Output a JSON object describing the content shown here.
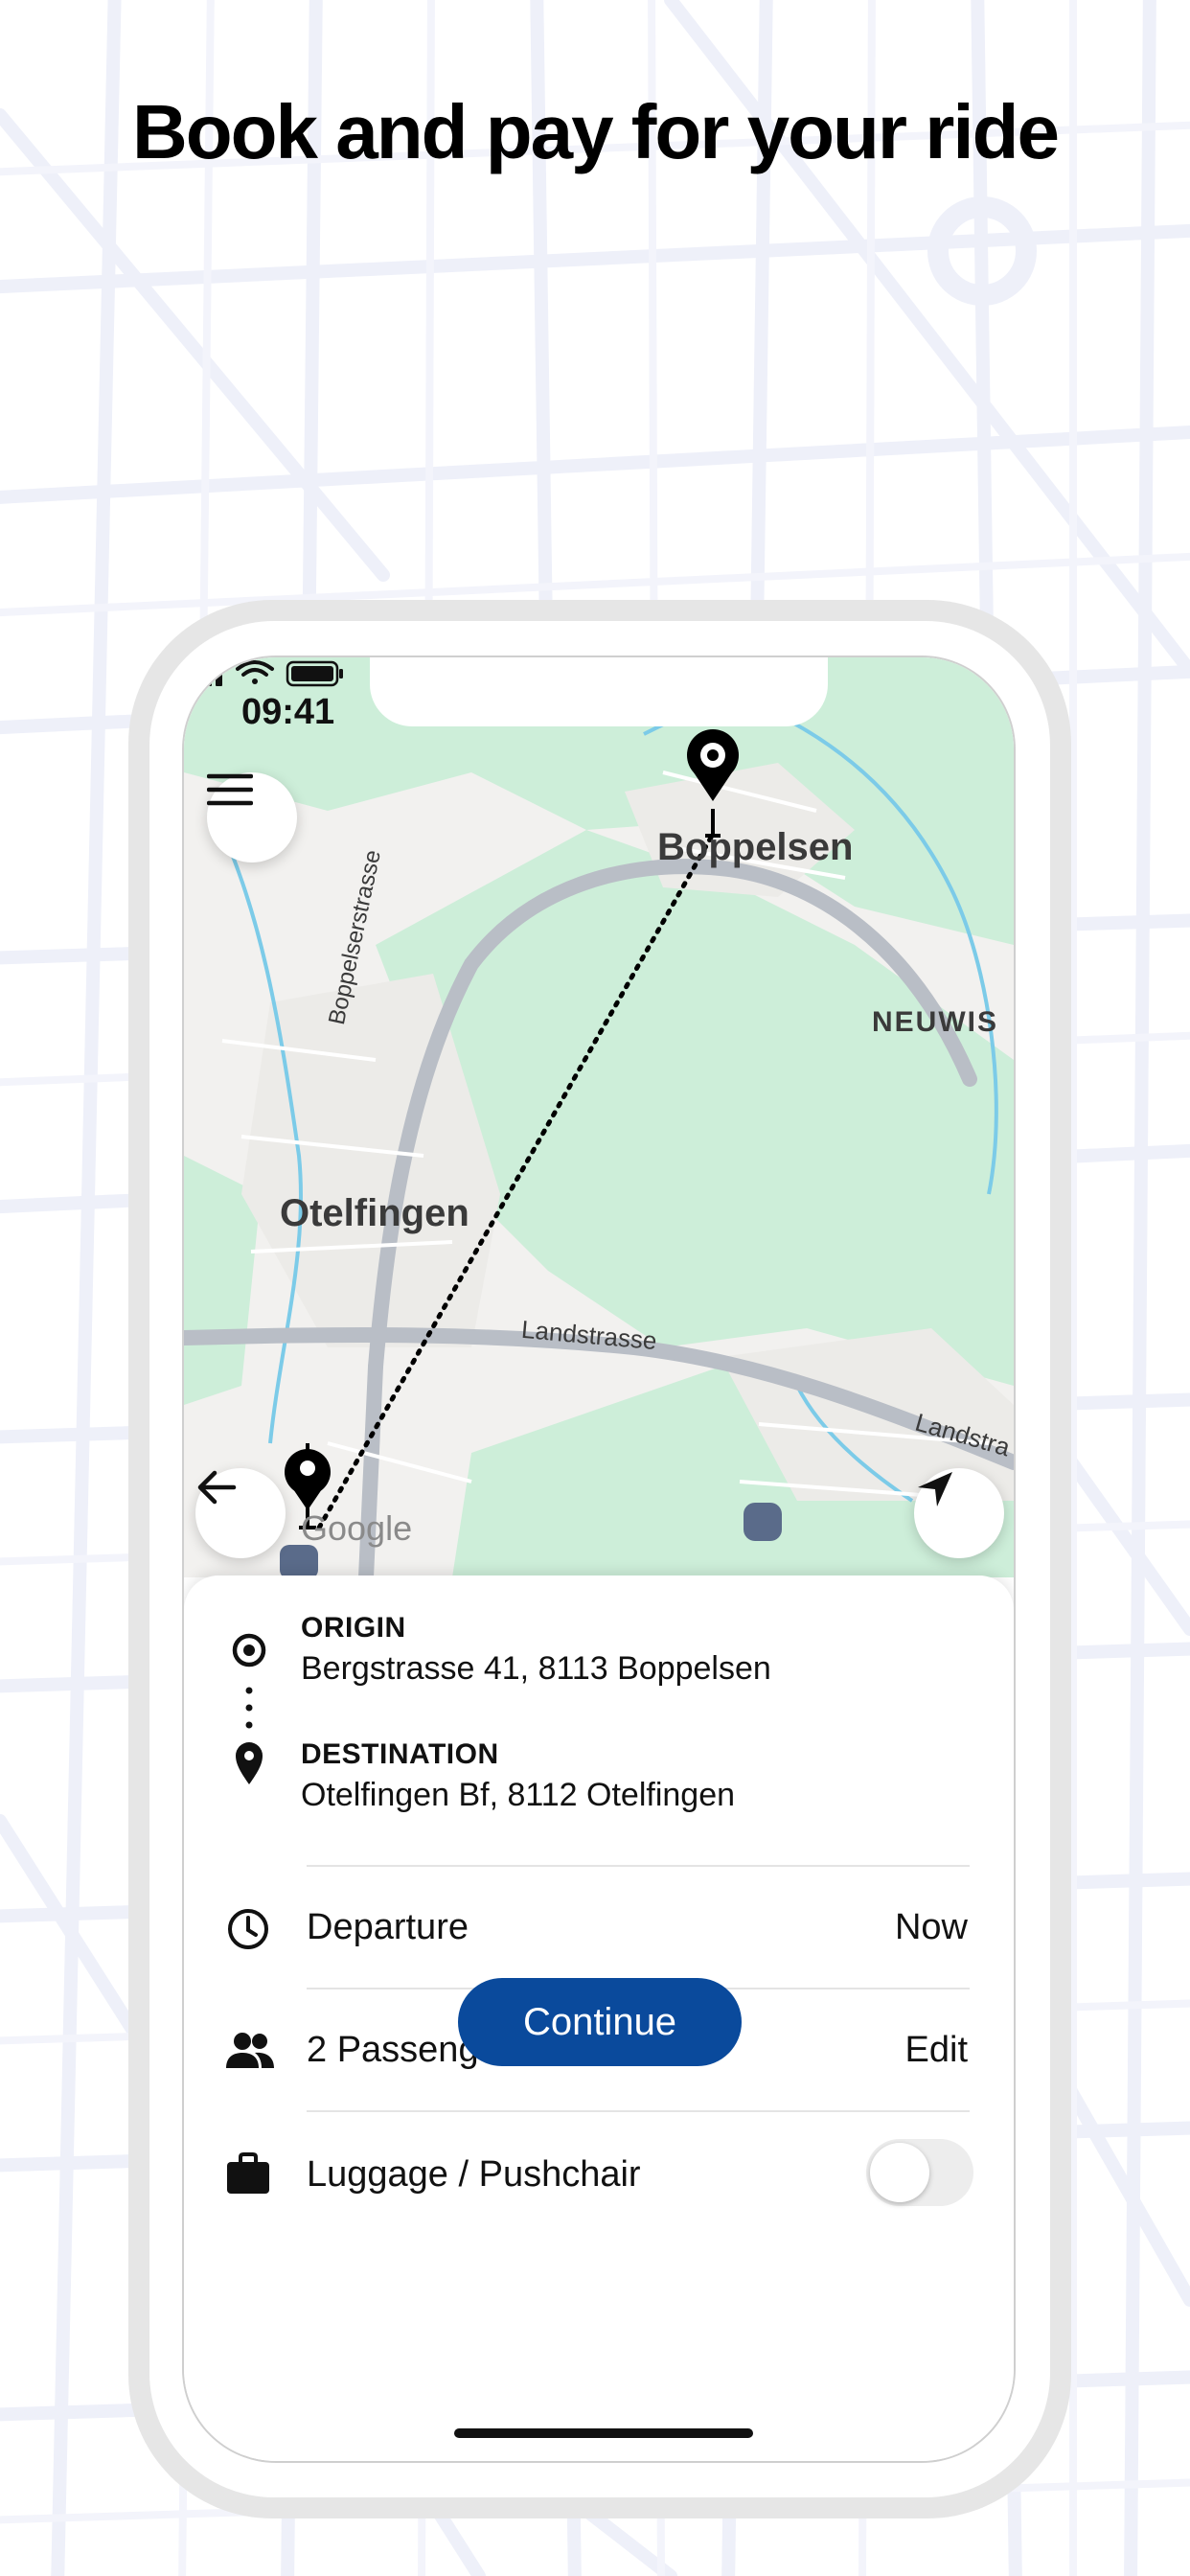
{
  "headline": "Book and pay for your ride",
  "status_bar": {
    "time": "09:41",
    "icons": [
      "signal-icon",
      "wifi-icon",
      "battery-icon"
    ]
  },
  "map": {
    "labels": {
      "boppelsen": "Boppelsen",
      "neuwis": "NEUWIS",
      "otelfingen": "Otelfingen",
      "boppelserstrasse": "Boppelserstrasse",
      "landstrasse_1": "Landstrasse",
      "landstrasse_2": "Landstra",
      "attribution": "Google"
    },
    "colors": {
      "green": "#cdeed9",
      "water": "#7ccbe8",
      "road": "#b9bec6"
    }
  },
  "route": {
    "origin_label": "ORIGIN",
    "origin_value": "Bergstrasse 41, 8113 Boppelsen",
    "destination_label": "DESTINATION",
    "destination_value": "Otelfingen Bf, 8112 Otelfingen"
  },
  "options": {
    "departure_label": "Departure",
    "departure_value": "Now",
    "passengers_label": "2 Passengers",
    "passengers_action": "Edit",
    "luggage_label": "Luggage / Pushchair",
    "luggage_toggle_on": false
  },
  "continue_label": "Continue",
  "accent_color": "#0a4a9c"
}
